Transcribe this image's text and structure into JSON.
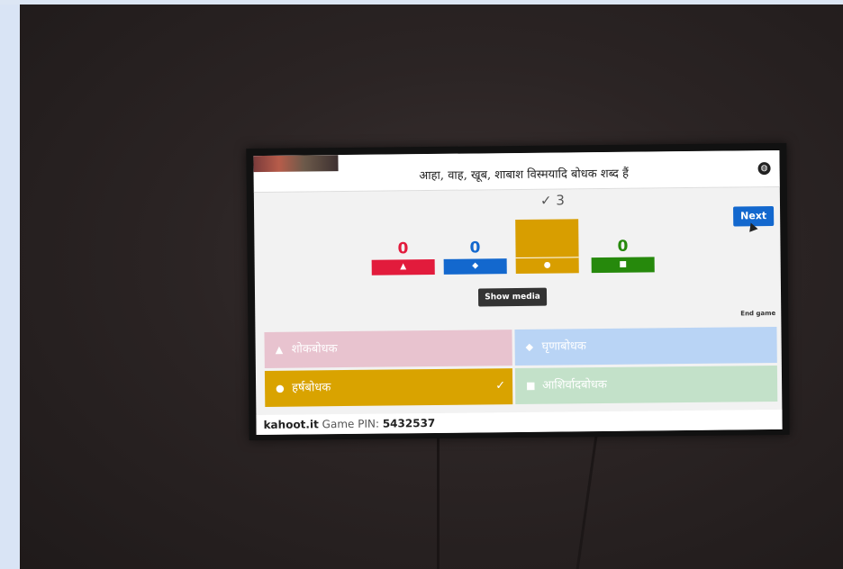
{
  "question": "आहा, वाह, खूब, शाबाश विस्मयादि बोधक शब्द हैं",
  "next_label": "Next",
  "show_media_label": "Show media",
  "end_game_label": "End game",
  "correct_indicator": "✓ 3",
  "bars": [
    {
      "count": "0",
      "color": "#e21b3c",
      "shape": "▲",
      "value": 0
    },
    {
      "count": "0",
      "color": "#1368ce",
      "shape": "◆",
      "value": 0
    },
    {
      "count": "3",
      "color": "#d89e00",
      "shape": "●",
      "value": 3
    },
    {
      "count": "0",
      "color": "#26890c",
      "shape": "■",
      "value": 0
    }
  ],
  "answers": [
    {
      "label": "शोकबोधक",
      "shape": "▲",
      "color": "#e8c3cf",
      "correct": false
    },
    {
      "label": "घृणाबोधक",
      "shape": "◆",
      "color": "#b9d4f5",
      "correct": false
    },
    {
      "label": "हर्षबोधक",
      "shape": "●",
      "color": "#d9a300",
      "correct": true
    },
    {
      "label": "आशिर्वादबोधक",
      "shape": "■",
      "color": "#c3e1c9",
      "correct": false
    }
  ],
  "footer": {
    "site": "kahoot.it",
    "pin_label": "Game PIN:",
    "pin": "5432537"
  }
}
